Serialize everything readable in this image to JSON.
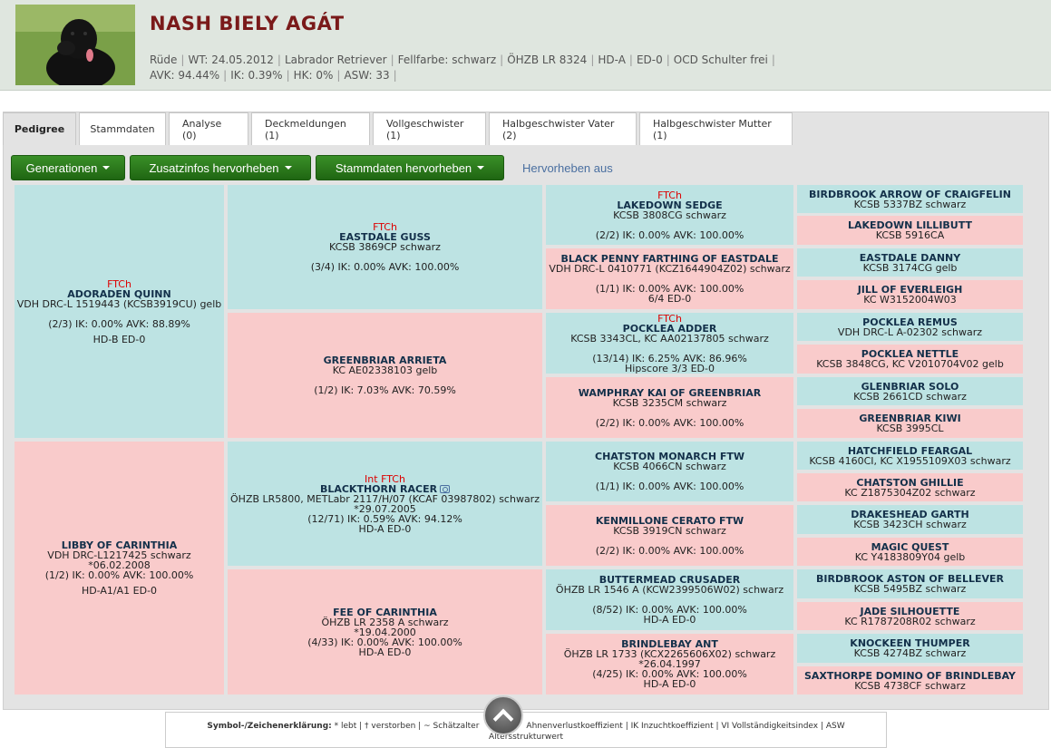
{
  "header": {
    "dog_name": "NASH BIELY AGÁT",
    "info1": [
      "Rüde",
      "WT: 24.05.2012",
      "Labrador Retriever",
      "Fellfarbe: schwarz",
      "ÖHZB LR 8324",
      "HD-A",
      "ED-0",
      "OCD Schulter frei"
    ],
    "info2": [
      "AVK: 94.44%",
      "IK: 0.39%",
      "HK: 0%",
      "ASW: 33"
    ],
    "separator": "|"
  },
  "tabs": [
    {
      "label": "Pedigree",
      "active": true
    },
    {
      "label": "Stammdaten"
    },
    {
      "label": "Analyse (0)"
    },
    {
      "label": "Deckmeldungen (1)"
    },
    {
      "label": "Vollgeschwister (1)"
    },
    {
      "label": "Halbgeschwister Vater (2)"
    },
    {
      "label": "Halbgeschwister Mutter (1)"
    }
  ],
  "toolbar": {
    "generationen": "Generationen",
    "zusatzinfos": "Zusatzinfos hervorheben",
    "stammdaten": "Stammdaten hervorheben",
    "hervorheben_aus": "Hervorheben aus"
  },
  "pedigree": {
    "g1": [
      {
        "title": "FTCh",
        "name": "ADORADEN QUINN",
        "reg": "VDH DRC-L 1519443 (KCSB3919CU) gelb",
        "stats": "(2/3) IK: 0.00% AVK: 88.89%",
        "extra": "HD-B ED-0"
      },
      {
        "title": "",
        "name": "LIBBY OF CARINTHIA",
        "reg": "VDH DRC-L1217425 schwarz",
        "date": "*06.02.2008",
        "stats": "(1/2) IK: 0.00% AVK: 100.00%",
        "extra": "HD-A1/A1 ED-0"
      }
    ],
    "g2": [
      {
        "title": "FTCh",
        "name": "EASTDALE GUSS",
        "reg": "KCSB 3869CP schwarz",
        "stats": "(3/4) IK: 0.00% AVK: 100.00%"
      },
      {
        "title": "",
        "name": "GREENBRIAR ARRIETA",
        "reg": "KC AE02338103 gelb",
        "stats": "(1/2) IK: 7.03% AVK: 70.59%"
      },
      {
        "title": "Int FTCh",
        "name": "BLACKTHORN RACER",
        "reg": "ÖHZB LR5800, METLabr 2117/H/07 (KCAF 03987802) schwarz",
        "date": "*29.07.2005",
        "stats": "(12/71) IK: 0.59% AVK: 94.12%",
        "extra": "HD-A ED-0"
      },
      {
        "title": "",
        "name": "FEE OF CARINTHIA",
        "reg": "ÖHZB LR 2358 A schwarz",
        "date": "*19.04.2000",
        "stats": "(4/33) IK: 0.00% AVK: 100.00%",
        "extra": "HD-A ED-0"
      }
    ],
    "g3": [
      {
        "title": "FTCh",
        "name": "LAKEDOWN SEDGE",
        "reg": "KCSB 3808CG schwarz",
        "stats": "(2/2) IK: 0.00% AVK: 100.00%"
      },
      {
        "title": "",
        "name": "BLACK PENNY FARTHING OF EASTDALE",
        "reg": "VDH DRC-L 0410771 (KCZ1644904Z02) schwarz",
        "stats": "(1/1) IK: 0.00% AVK: 100.00%",
        "extra": "6/4 ED-0"
      },
      {
        "title": "FTCh",
        "name": "POCKLEA ADDER",
        "reg": "KCSB 3343CL, KC AA02137805 schwarz",
        "stats": "(13/14) IK: 6.25% AVK: 86.96%",
        "extra": "Hipscore 3/3 ED-0"
      },
      {
        "title": "",
        "name": "WAMPHRAY KAI OF GREENBRIAR",
        "reg": "KCSB 3235CM schwarz",
        "stats": "(2/2) IK: 0.00% AVK: 100.00%"
      },
      {
        "title": "",
        "name": "CHATSTON MONARCH FTW",
        "reg": "KCSB 4066CN schwarz",
        "stats": "(1/1) IK: 0.00% AVK: 100.00%"
      },
      {
        "title": "",
        "name": "KENMILLONE CERATO FTW",
        "reg": "KCSB 3919CN schwarz",
        "stats": "(2/2) IK: 0.00% AVK: 100.00%"
      },
      {
        "title": "",
        "name": "BUTTERMEAD CRUSADER",
        "reg": "ÖHZB LR 1546 A (KCW2399506W02) schwarz",
        "stats": "(8/52) IK: 0.00% AVK: 100.00%",
        "extra": "HD-A ED-0"
      },
      {
        "title": "",
        "name": "BRINDLEBAY ANT",
        "reg": "ÖHZB LR 1733 (KCX2265606X02) schwarz",
        "date": "*26.04.1997",
        "stats": "(4/25) IK: 0.00% AVK: 100.00%",
        "extra": "HD-A ED-0"
      }
    ],
    "g4": [
      {
        "name": "BIRDBROOK ARROW OF CRAIGFELIN",
        "reg": "KCSB 5337BZ schwarz"
      },
      {
        "name": "LAKEDOWN LILLIBUTT",
        "reg": "KCSB 5916CA"
      },
      {
        "name": "EASTDALE DANNY",
        "reg": "KCSB 3174CG gelb"
      },
      {
        "name": "JILL OF EVERLEIGH",
        "reg": "KC W3152004W03"
      },
      {
        "name": "POCKLEA REMUS",
        "reg": "VDH DRC-L A-02302 schwarz"
      },
      {
        "name": "POCKLEA NETTLE",
        "reg": "KCSB 3848CG, KC V2010704V02 gelb"
      },
      {
        "name": "GLENBRIAR SOLO",
        "reg": "KCSB 2661CD schwarz"
      },
      {
        "name": "GREENBRIAR KIWI",
        "reg": "KCSB 3995CL"
      },
      {
        "name": "HATCHFIELD FEARGAL",
        "reg": "KCSB 4160CI, KC X1955109X03 schwarz"
      },
      {
        "name": "CHATSTON GHILLIE",
        "reg": "KC Z1875304Z02 schwarz"
      },
      {
        "name": "DRAKESHEAD GARTH",
        "reg": "KCSB 3423CH schwarz"
      },
      {
        "name": "MAGIC QUEST",
        "reg": "KC Y4183809Y04 gelb"
      },
      {
        "name": "BIRDBROOK ASTON OF BELLEVER",
        "reg": "KCSB 5495BZ schwarz"
      },
      {
        "name": "JADE SILHOUETTE",
        "reg": "KC R1787208R02 schwarz"
      },
      {
        "name": "KNOCKEEN THUMPER",
        "reg": "KCSB 4274BZ schwarz"
      },
      {
        "name": "SAXTHORPE DOMINO OF BRINDLEBAY",
        "reg": "KCSB 4738CF schwarz"
      }
    ]
  },
  "legend": {
    "label": "Symbol-/Zeichenerklärung:",
    "text1": " * lebt | † verstorben | ~ Schätzalter",
    "text2": "Ahnenverlustkoeffizient | IK Inzuchtkoeffizient | VI Vollständigkeitsindex | ASW",
    "text3": "Altersstrukturwert"
  },
  "colors": {
    "male": "#bde3e3",
    "female": "#f9cbcb",
    "title_red": "#dd0000",
    "name_blue": "#13304a",
    "button_green": "#2e7d1f"
  }
}
